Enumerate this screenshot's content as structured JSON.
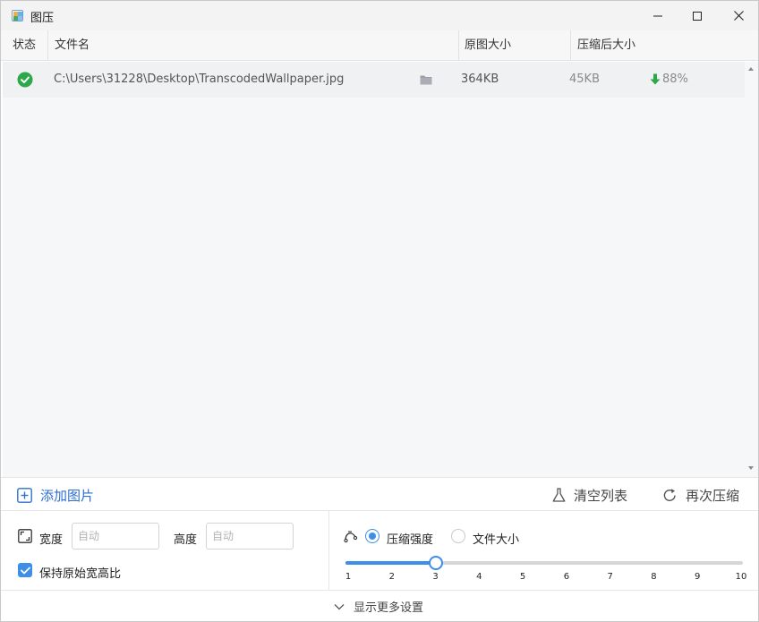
{
  "window": {
    "title": "图压",
    "controls": [
      "minimize",
      "maximize",
      "close"
    ]
  },
  "table": {
    "columns": {
      "status": "状态",
      "filename": "文件名",
      "original_size": "原图大小",
      "compressed_size": "压缩后大小"
    },
    "rows": [
      {
        "status": "done",
        "filename": "C:\\Users\\31228\\Desktop\\TranscodedWallpaper.jpg",
        "original_size": "364KB",
        "compressed_size": "45KB",
        "ratio": "88%"
      }
    ]
  },
  "toolbar": {
    "add_label": "添加图片",
    "clear_label": "清空列表",
    "recompress_label": "再次压缩"
  },
  "settings": {
    "width_label": "宽度",
    "width_placeholder": "自动",
    "height_label": "高度",
    "height_placeholder": "自动",
    "keep_ratio_label": "保持原始宽高比",
    "keep_ratio_checked": true,
    "mode_strength_label": "压缩强度",
    "mode_filesize_label": "文件大小",
    "selected_mode": "strength",
    "strength_value": 3,
    "strength_min": 1,
    "strength_max": 10,
    "strength_ticks": [
      "1",
      "2",
      "3",
      "4",
      "5",
      "6",
      "7",
      "8",
      "9",
      "10"
    ]
  },
  "footer": {
    "more_settings_label": "显示更多设置"
  },
  "colors": {
    "accent": "#3d8ee8",
    "link": "#2f6fd0",
    "success": "#2ca84a"
  }
}
